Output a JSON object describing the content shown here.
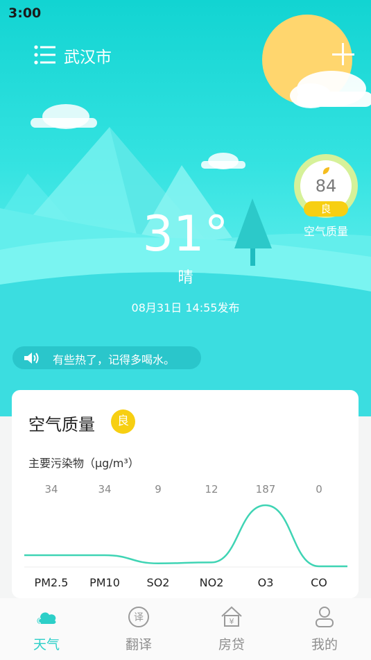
{
  "status_bar": {
    "time": "3:00"
  },
  "header": {
    "city": "武汉市"
  },
  "weather": {
    "temperature": "31°",
    "condition": "晴",
    "published": "08月31日 14:55发布",
    "tip": "有些热了，记得多喝水。"
  },
  "aqi_badge": {
    "value": "84",
    "grade": "良",
    "label": "空气质量"
  },
  "air_card": {
    "title": "空气质量",
    "grade": "良",
    "subtitle": "主要污染物（μg/m³）",
    "pollutants": [
      {
        "name": "PM2.5",
        "value": "34"
      },
      {
        "name": "PM10",
        "value": "34"
      },
      {
        "name": "SO2",
        "value": "9"
      },
      {
        "name": "NO2",
        "value": "12"
      },
      {
        "name": "O3",
        "value": "187"
      },
      {
        "name": "CO",
        "value": "0"
      }
    ]
  },
  "chart_data": {
    "type": "line",
    "categories": [
      "PM2.5",
      "PM10",
      "SO2",
      "NO2",
      "O3",
      "CO"
    ],
    "values": [
      34,
      34,
      9,
      12,
      187,
      0
    ],
    "title": "",
    "xlabel": "",
    "ylabel": ""
  },
  "tabs": [
    {
      "label": "天气",
      "icon": "cloud-icon",
      "active": true
    },
    {
      "label": "翻译",
      "icon": "translate-icon",
      "active": false
    },
    {
      "label": "房贷",
      "icon": "house-loan-icon",
      "active": false
    },
    {
      "label": "我的",
      "icon": "person-icon",
      "active": false
    }
  ],
  "colors": {
    "accent": "#2ccfc8",
    "grade": "#f7cf12",
    "sky": "#35e3e1"
  }
}
